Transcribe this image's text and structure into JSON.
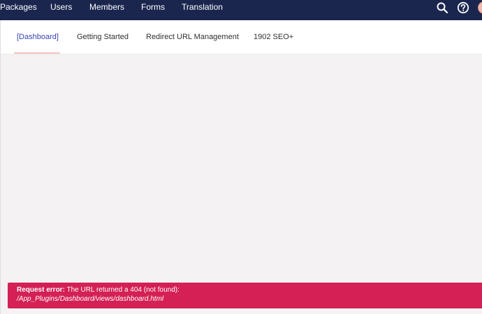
{
  "topbar": {
    "nav": [
      {
        "label": "Packages"
      },
      {
        "label": "Users"
      },
      {
        "label": "Members"
      },
      {
        "label": "Forms"
      },
      {
        "label": "Translation"
      }
    ],
    "icons": [
      "search-icon",
      "help-icon",
      "avatar"
    ]
  },
  "tabs": [
    {
      "label": "[Dashboard]",
      "active": true
    },
    {
      "label": "Getting Started",
      "active": false
    },
    {
      "label": "Redirect URL Management",
      "active": false
    },
    {
      "label": "1902 SEO+",
      "active": false
    }
  ],
  "error": {
    "title": "Request error:",
    "message": "The URL returned a 404 (not found):",
    "path": "/App_Plugins/Dashboard/views/dashboard.html"
  },
  "colors": {
    "topbar": "#1b264f",
    "active_tab": "#3544b1",
    "tab_underline": "#f5c1bc",
    "error_background": "#d42054",
    "content_background": "#f4f2f2"
  }
}
